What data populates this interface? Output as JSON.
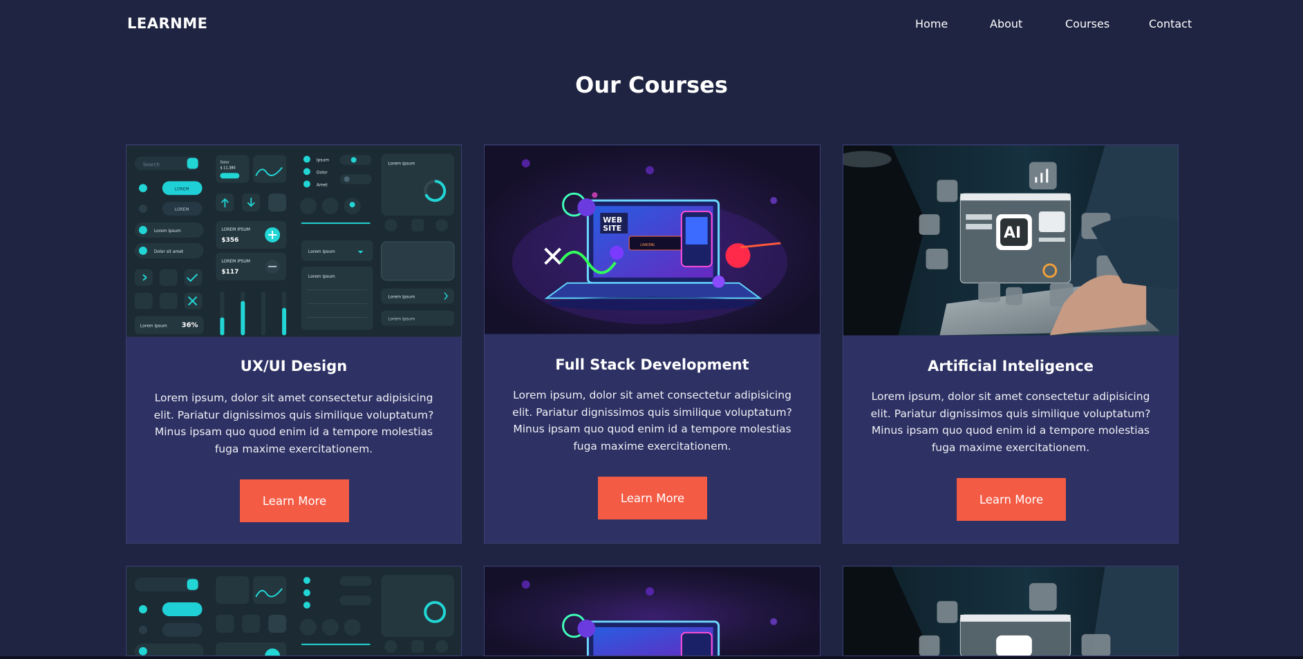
{
  "nav": {
    "logo": "LEARNME",
    "links": [
      "Home",
      "About",
      "Courses",
      "Contact"
    ]
  },
  "page_title": "Our Courses",
  "courses": [
    {
      "title": "UX/UI Design",
      "description": "Lorem ipsum, dolor sit amet consectetur adipisicing elit. Pariatur dignissimos quis similique voluptatum? Minus ipsam quo quod enim id a tempore molestias fuga maxime exercitationem.",
      "button": "Learn More",
      "image": "ui-kit-illustration"
    },
    {
      "title": "Full Stack Development",
      "description": "Lorem ipsum, dolor sit amet consectetur adipisicing elit. Pariatur dignissimos quis similique voluptatum? Minus ipsam quo quod enim id a tempore molestias fuga maxime exercitationem.",
      "button": "Learn More",
      "image": "neon-laptop-illustration"
    },
    {
      "title": "Artificial Inteligence",
      "description": "Lorem ipsum, dolor sit amet consectetur adipisicing elit. Pariatur dignissimos quis similique voluptatum? Minus ipsam quo quod enim id a tempore molestias fuga maxime exercitationem.",
      "button": "Learn More",
      "image": "ai-laptop-photo"
    }
  ],
  "ui_kit_text": {
    "search": "Search",
    "lorem_btn": "LOREM",
    "lorem_ipsum": "Lorem Ipsum",
    "dolor_sit_amet": "Dolor sit amet",
    "price1": "$356",
    "price2": "$117",
    "price_label": "LOREM IPSUM",
    "percent": "36%",
    "dolor": "Dolor",
    "amount": "$ 11,380",
    "ipsum": "Ipsum",
    "amet": "Amet"
  },
  "neon_text": {
    "web": "WEB",
    "site": "SITE",
    "loading": "LOADING"
  },
  "ai_text": {
    "ai": "AI"
  },
  "colors": {
    "background": "#1f2442",
    "card": "#2d3163",
    "button": "#f45b45"
  }
}
